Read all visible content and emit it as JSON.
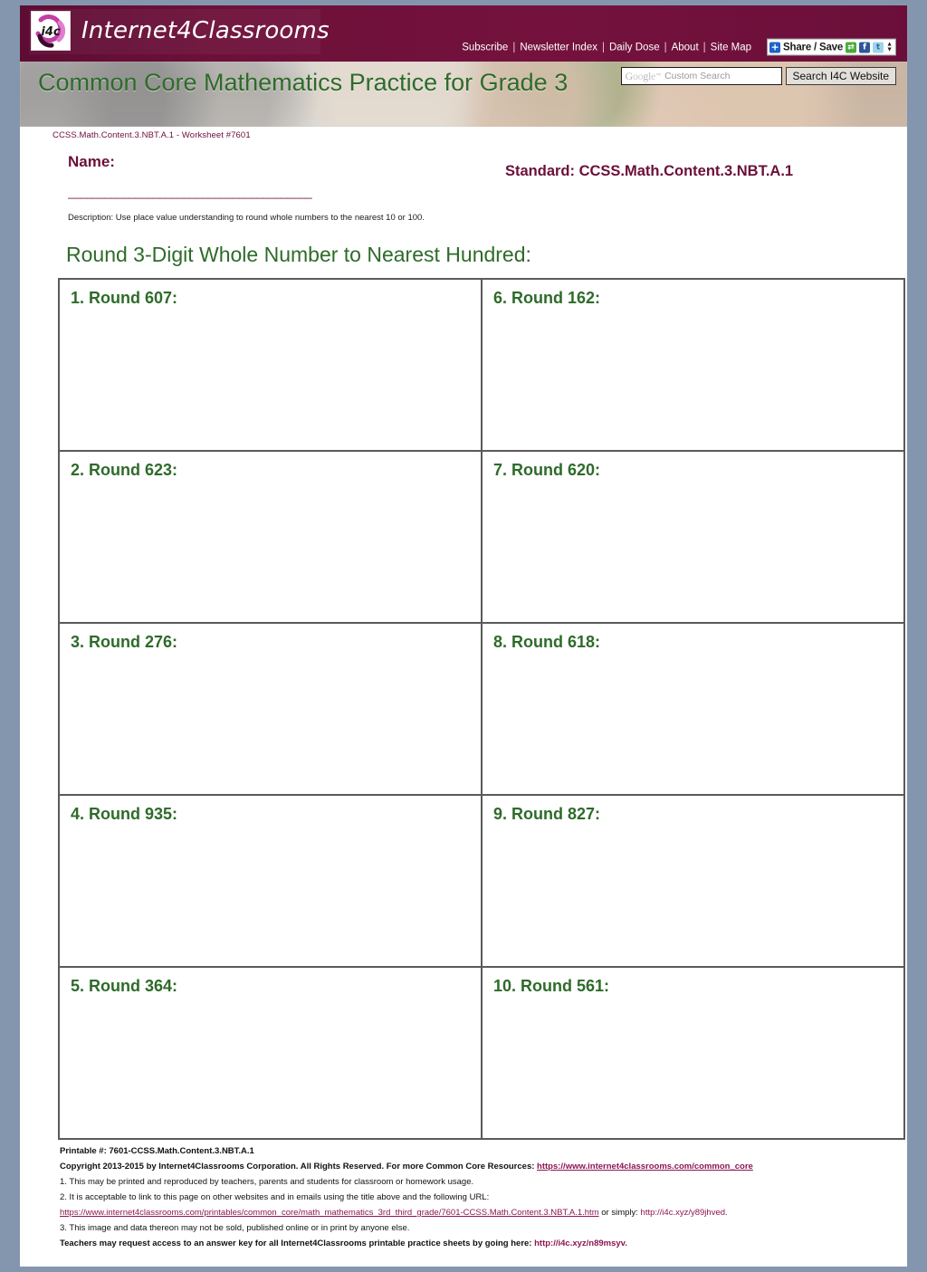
{
  "colors": {
    "maroon": "#6b0f3a",
    "green": "#2e6b2a",
    "page_bg": "#8496ad"
  },
  "header": {
    "brand_name": "Internet4Classrooms",
    "logo_text": "i4c",
    "nav": [
      {
        "label": "Subscribe"
      },
      {
        "label": "Newsletter Index"
      },
      {
        "label": "Daily Dose"
      },
      {
        "label": "About"
      },
      {
        "label": "Site Map"
      }
    ],
    "share": {
      "label": "Share / Save",
      "plus": "+",
      "icons": [
        "share-icon",
        "facebook-icon",
        "twitter-icon"
      ],
      "up_arrow": "▲",
      "down_arrow": "▼"
    },
    "search": {
      "google_logo": "Google",
      "tm": "™",
      "placeholder": "Custom Search",
      "value": "",
      "button_label": "Search I4C Website"
    }
  },
  "title": "Common Core Mathematics Practice for Grade 3",
  "worksheet": {
    "id_line": "CCSS.Math.Content.3.NBT.A.1 - Worksheet #7601",
    "name_label": "Name:",
    "name_rule": "________________________________________",
    "standard": "Standard: CCSS.Math.Content.3.NBT.A.1",
    "description": "Description: Use place value understanding to round whole numbers to the nearest 10 or 100.",
    "heading": "Round 3-Digit Whole Number to Nearest Hundred:",
    "problems": [
      {
        "label": "1. Round 607:"
      },
      {
        "label": "6. Round 162:"
      },
      {
        "label": "2. Round 623:"
      },
      {
        "label": "7. Round 620:"
      },
      {
        "label": "3. Round 276:"
      },
      {
        "label": "8. Round 618:"
      },
      {
        "label": "4. Round 935:"
      },
      {
        "label": "9. Round 827:"
      },
      {
        "label": "5. Round 364:"
      },
      {
        "label": "10. Round 561:"
      }
    ]
  },
  "footer": {
    "printable": "Printable #: 7601-CCSS.Math.Content.3.NBT.A.1",
    "copyright_pre": "Copyright 2013-2015 by Internet4Classrooms Corporation. All Rights Reserved. For more Common Core Resources: ",
    "copyright_link": "https://www.internet4classrooms.com/common_core",
    "line1": "1. This may be printed and reproduced by teachers, parents and students for classroom or homework usage.",
    "line2": "2. It is acceptable to link to this page on other websites and in emails using the title above and the following URL:",
    "url_long": "https://www.internet4classrooms.com/printables/common_core/math_mathematics_3rd_third_grade/7601-CCSS.Math.Content.3.NBT.A.1.htm",
    "url_mid": " or simply: ",
    "url_short": "http://i4c.xyz/y89jhved.",
    "line3": "3. This image and data thereon may not be sold, published online or in print by anyone else.",
    "teachers_pre": "Teachers may request access to an answer key for all Internet4Classrooms printable practice sheets by going here: ",
    "teachers_link": "http://i4c.xyz/n89msyv."
  }
}
